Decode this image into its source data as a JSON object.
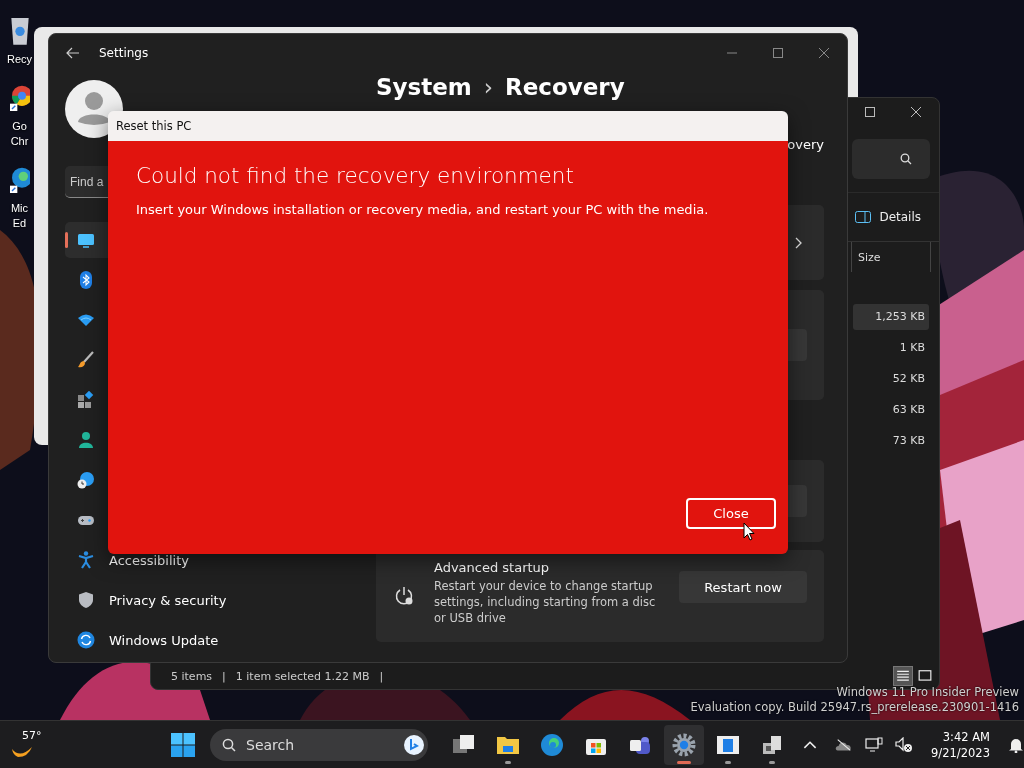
{
  "desktop": {
    "icons": [
      {
        "label": "Recy"
      },
      {
        "label": "Go Chr"
      },
      {
        "label": "Mic Ed"
      }
    ]
  },
  "explorer": {
    "details_label": "Details",
    "column": "Size",
    "rows": [
      {
        "size": "1,253 KB",
        "selected": true
      },
      {
        "size": "1 KB",
        "selected": false
      },
      {
        "size": "52 KB",
        "selected": false
      },
      {
        "size": "63 KB",
        "selected": false
      },
      {
        "size": "73 KB",
        "selected": false
      }
    ],
    "status": [
      "5 items",
      "|",
      "1 item selected  1.22 MB",
      "|"
    ],
    "views": [
      {
        "selected": true
      },
      {
        "selected": false
      }
    ]
  },
  "settings": {
    "title": "Settings",
    "breadcrumb": [
      "System",
      "›",
      "Recovery"
    ],
    "search": {
      "placeholder": "Find a"
    },
    "nav": [
      {
        "selected": true
      },
      {
        "selected": false
      },
      {
        "selected": false
      },
      {
        "selected": false
      },
      {
        "selected": false
      },
      {
        "selected": false
      },
      {
        "selected": false
      },
      {
        "selected": false
      },
      {
        "label": "Accessibility",
        "selected": false
      },
      {
        "label": "Privacy & security",
        "selected": false
      },
      {
        "label": "Windows Update",
        "selected": false
      }
    ],
    "subtitle_fragment": "overy",
    "advanced_startup": {
      "title": "Advanced startup",
      "description": "Restart your device to change startup settings, including starting from a disc or USB drive",
      "button": "Restart now"
    }
  },
  "dialog": {
    "title": "Reset this PC",
    "heading": "Could not find the recovery environment",
    "message": "Insert your Windows installation or recovery media, and restart your PC with the media.",
    "button": "Close"
  },
  "watermark": [
    "Windows 11 Pro Insider Preview",
    "Evaluation copy. Build 25947.rs_prerelease.230901-1416"
  ],
  "taskbar": {
    "weather": "57°",
    "search": {
      "placeholder": "Search"
    },
    "apps": [
      {
        "running": false,
        "selected": false
      },
      {
        "running": true,
        "selected": false
      },
      {
        "running": false,
        "selected": false
      },
      {
        "running": false,
        "selected": false
      },
      {
        "running": false,
        "selected": false
      },
      {
        "running": true,
        "selected": true
      },
      {
        "running": true,
        "selected": false
      },
      {
        "running": true,
        "selected": false
      }
    ],
    "clock": {
      "time": "3:42 AM",
      "date": "9/21/2023"
    }
  }
}
